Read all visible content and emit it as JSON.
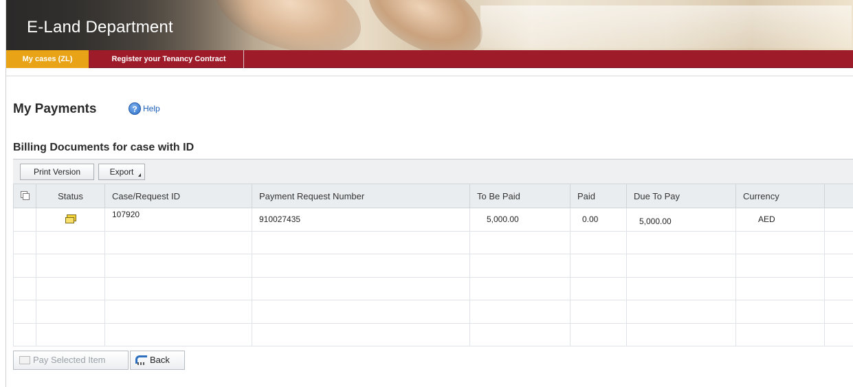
{
  "header": {
    "title": "E-Land Department",
    "tabs": [
      {
        "label": "My cases (ZL)",
        "active": true
      },
      {
        "label": "Register your Tenancy Contract",
        "active": false
      }
    ]
  },
  "page": {
    "title": "My Payments",
    "help_label": "Help",
    "section_title": "Billing Documents for case with ID"
  },
  "toolbar": {
    "print_label": "Print Version",
    "export_label": "Export"
  },
  "table": {
    "columns": [
      "Status",
      "Case/Request ID",
      "Payment Request Number",
      "To Be Paid",
      "Paid",
      "Due To Pay",
      "Currency"
    ],
    "rows": [
      {
        "status_icon": "status-document-icon",
        "case_id": "107920",
        "payment_request_number": "910027435",
        "to_be_paid": "5,000.00",
        "paid": "0.00",
        "due_to_pay": "5,000.00",
        "currency": "AED"
      }
    ]
  },
  "footer": {
    "pay_label": "Pay Selected Item",
    "back_label": "Back"
  },
  "colors": {
    "navbar": "#9e1b2a",
    "active_tab": "#e8a317",
    "help_link": "#1a5db8"
  }
}
